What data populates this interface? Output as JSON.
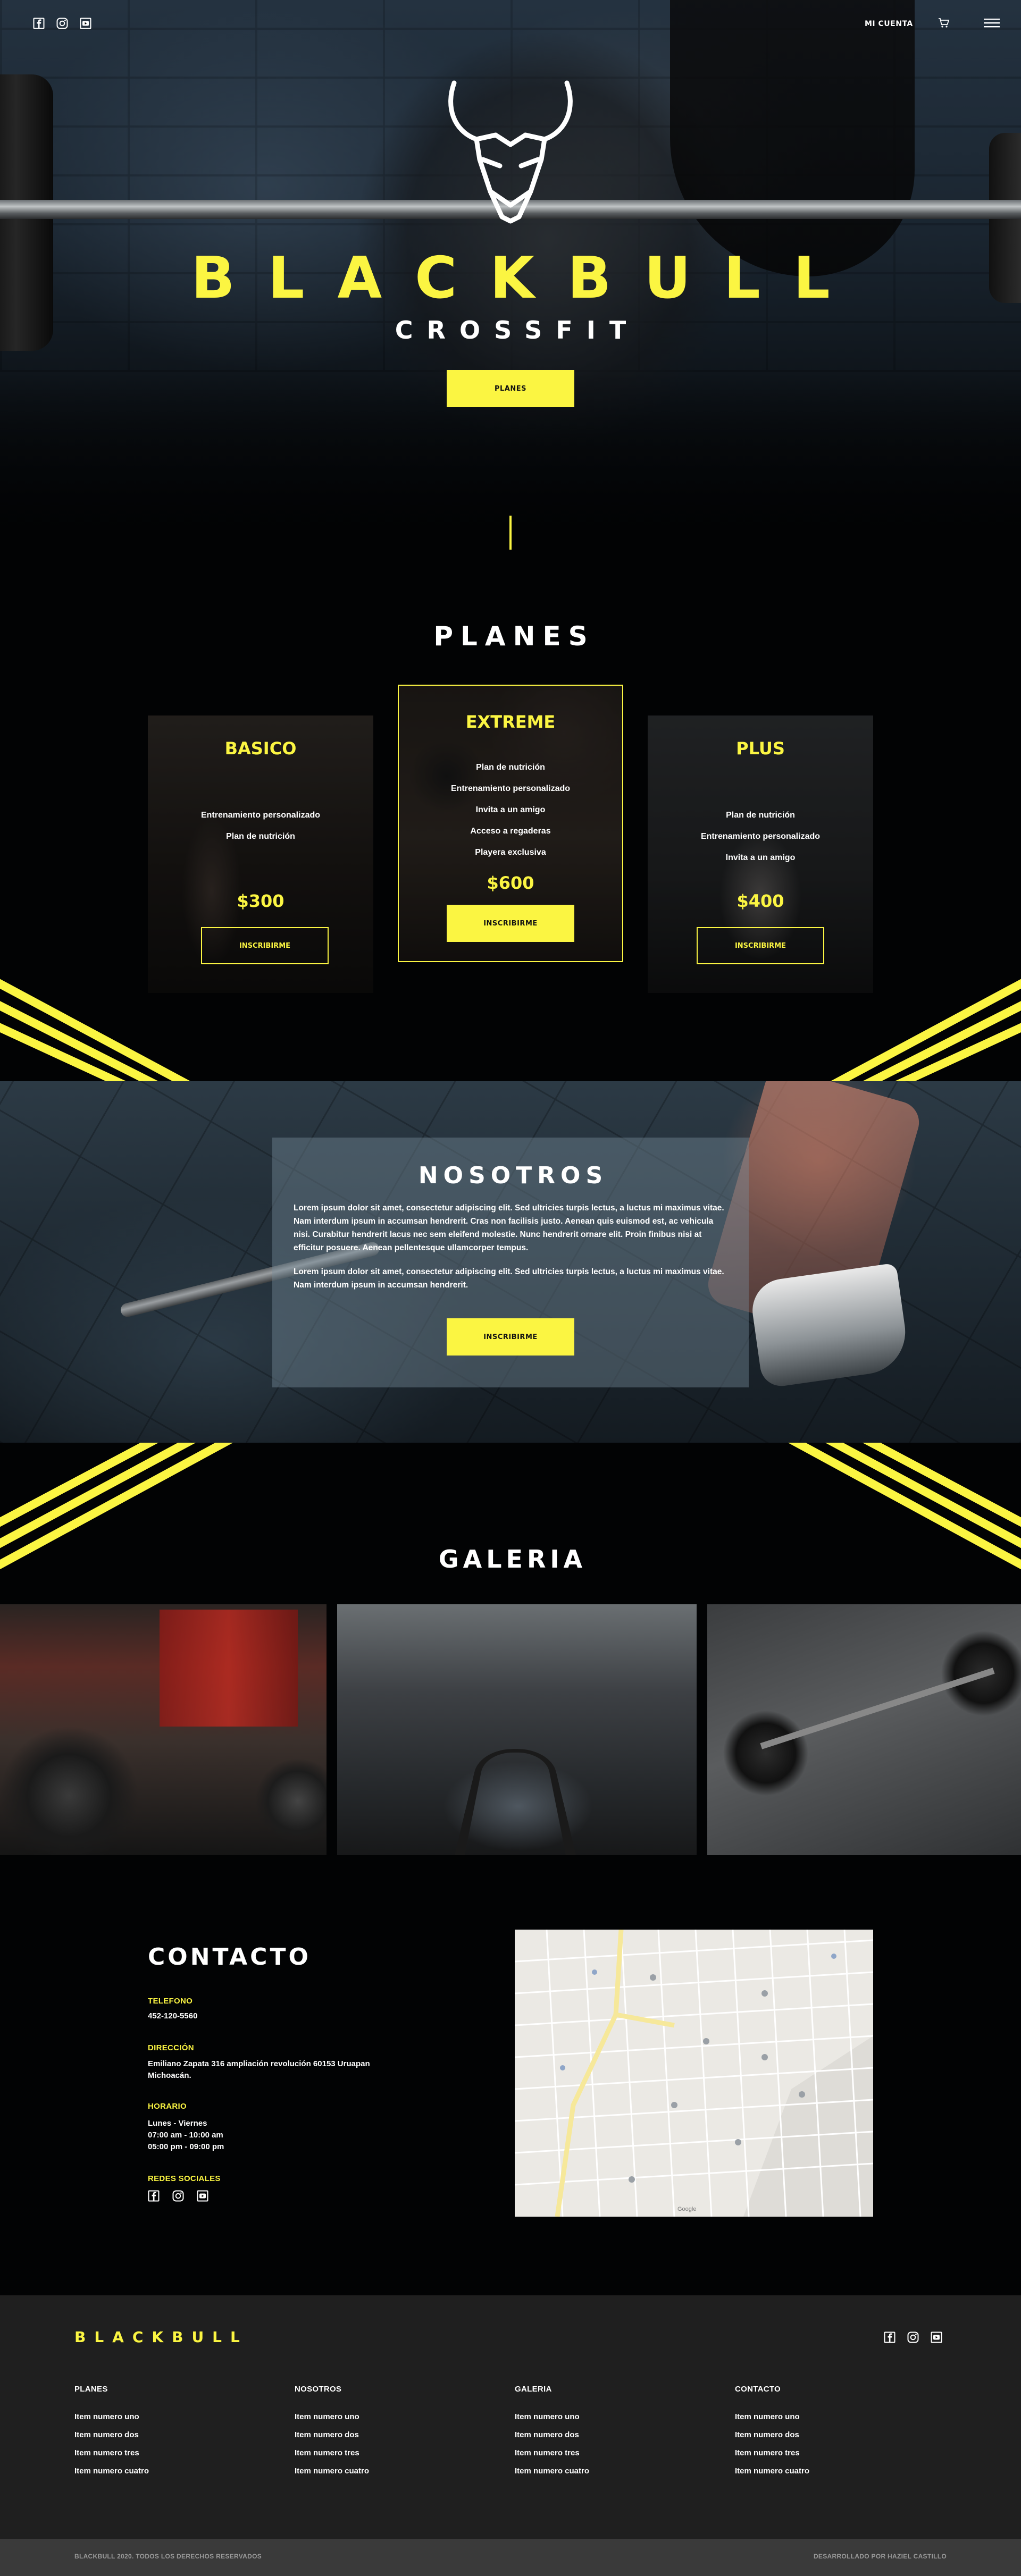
{
  "colors": {
    "accent": "#fbf542",
    "background": "#020304",
    "footer": "#1f1f1f",
    "bottom_bar": "#3a3a3a"
  },
  "header": {
    "social_icons": [
      "facebook-icon",
      "instagram-icon",
      "youtube-icon"
    ],
    "account_label": "MI CUENTA",
    "cart_icon": "cart-icon",
    "menu_icon": "hamburger-menu-icon"
  },
  "hero": {
    "logo_icon": "bull-head-logo-icon",
    "title": "BLACKBULL",
    "subtitle": "CROSSFIT",
    "button_label": "PLANES"
  },
  "planes": {
    "title": "PLANES",
    "cards": [
      {
        "name": "BASICO",
        "features": [
          "Entrenamiento personalizado",
          "Plan de nutrición"
        ],
        "price": "$300",
        "button_label": "INSCRIBIRME"
      },
      {
        "name": "EXTREME",
        "features": [
          "Plan de nutrición",
          "Entrenamiento personalizado",
          "Invita a un amigo",
          "Acceso a regaderas",
          "Playera exclusiva"
        ],
        "price": "$600",
        "button_label": "INSCRIBIRME"
      },
      {
        "name": "PLUS",
        "features": [
          "Plan de nutrición",
          "Entrenamiento personalizado",
          "Invita a un amigo"
        ],
        "price": "$400",
        "button_label": "INSCRIBIRME"
      }
    ]
  },
  "nosotros": {
    "title": "NOSOTROS",
    "paragraphs": [
      "Lorem ipsum dolor sit amet, consectetur adipiscing elit. Sed ultricies turpis lectus, a luctus mi maximus vitae. Nam interdum ipsum in accumsan hendrerit. Cras non facilisis justo. Aenean quis euismod est, ac vehicula nisi. Curabitur hendrerit lacus nec sem eleifend molestie. Nunc hendrerit ornare elit. Proin finibus nisi at efficitur posuere. Aenean pellentesque ullamcorper tempus.",
      "Lorem ipsum dolor sit amet, consectetur adipiscing elit. Sed ultricies turpis lectus, a luctus mi maximus vitae. Nam interdum ipsum in accumsan hendrerit."
    ],
    "button_label": "INSCRIBIRME"
  },
  "galeria": {
    "title": "GALERIA"
  },
  "contacto": {
    "title": "CONTACTO",
    "telefono_label": "TELEFONO",
    "telefono": "452-120-5560",
    "direccion_label": "DIRECCIÓN",
    "direccion": "Emiliano Zapata 316 ampliación revolución 60153 Uruapan\nMichoacán.",
    "horario_label": "HORARIO",
    "horario": "Lunes - Viernes\n07:00 am - 10:00 am\n05:00 pm - 09:00 pm",
    "redes_label": "REDES SOCIALES",
    "social_icons": [
      "facebook-icon",
      "instagram-icon",
      "youtube-icon"
    ],
    "map_credit": "Google"
  },
  "footer": {
    "brand": "BLACKBULL",
    "social_icons": [
      "facebook-icon",
      "instagram-icon",
      "youtube-icon"
    ],
    "columns": [
      {
        "title": "PLANES",
        "items": [
          "Item numero uno",
          "Item numero dos",
          "Item numero tres",
          "Item numero cuatro"
        ]
      },
      {
        "title": "NOSOTROS",
        "items": [
          "Item numero uno",
          "Item numero dos",
          "Item numero tres",
          "Item numero cuatro"
        ]
      },
      {
        "title": "GALERIA",
        "items": [
          "Item numero uno",
          "Item numero dos",
          "Item numero tres",
          "Item numero cuatro"
        ]
      },
      {
        "title": "CONTACTO",
        "items": [
          "Item numero uno",
          "Item numero dos",
          "Item numero tres",
          "Item numero cuatro"
        ]
      }
    ],
    "copyright": "BLACKBULL 2020. TODOS LOS DERECHOS RESERVADOS",
    "credit": "DESARROLLADO POR HAZIEL CASTILLO"
  }
}
